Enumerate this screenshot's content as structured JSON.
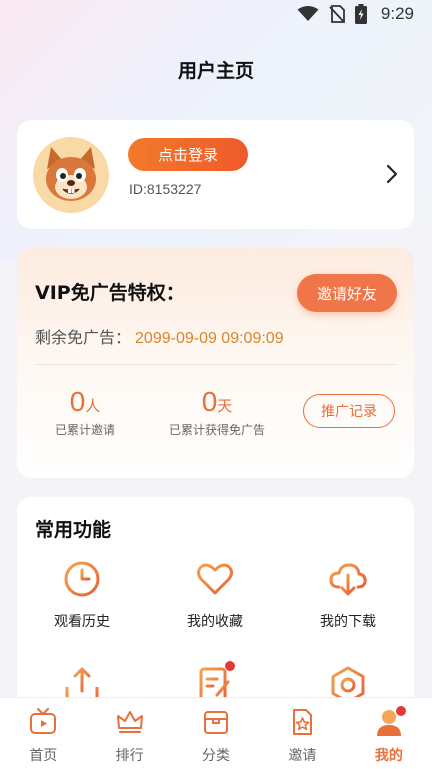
{
  "status_bar": {
    "time": "9:29"
  },
  "page": {
    "title": "用户主页"
  },
  "profile": {
    "login_label": "点击登录",
    "user_id": "ID:8153227"
  },
  "vip": {
    "title": "VIP免广告特权：",
    "invite_label": "邀请好友",
    "remaining_label": "剩余免广告：",
    "remaining_value": "2099-09-09 09:09:09",
    "invited_count": "0",
    "invited_unit": "人",
    "invited_label": "已累计邀请",
    "days_count": "0",
    "days_unit": "天",
    "days_label": "已累计获得免广告",
    "record_label": "推广记录"
  },
  "functions": {
    "title": "常用功能",
    "items": [
      {
        "label": "观看历史",
        "icon": "clock-icon"
      },
      {
        "label": "我的收藏",
        "icon": "heart-icon"
      },
      {
        "label": "我的下载",
        "icon": "cloud-download-icon"
      },
      {
        "label": "",
        "icon": "upload-icon"
      },
      {
        "label": "",
        "icon": "edit-note-icon"
      },
      {
        "label": "",
        "icon": "hexagon-settings-icon"
      }
    ]
  },
  "tabs": [
    {
      "label": "首页",
      "icon": "tv-icon"
    },
    {
      "label": "排行",
      "icon": "crown-icon"
    },
    {
      "label": "分类",
      "icon": "box-icon"
    },
    {
      "label": "邀请",
      "icon": "star-card-icon"
    },
    {
      "label": "我的",
      "icon": "user-icon",
      "active": true
    }
  ],
  "colors": {
    "accent": "#e8703b",
    "button_orange": "#f07649",
    "badge_red": "#e53935"
  }
}
